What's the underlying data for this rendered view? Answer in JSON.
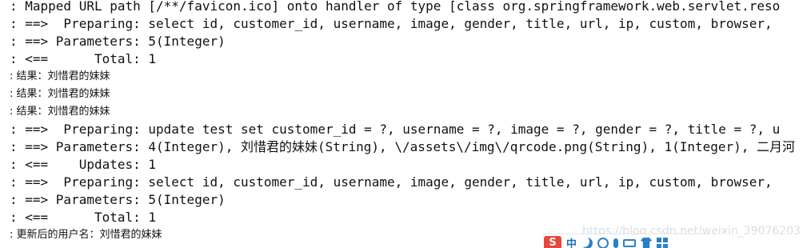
{
  "console": {
    "lines": [
      ": Mapped URL path [/**/favicon.ico] onto handler of type [class org.springframework.web.servlet.reso",
      ": ==>  Preparing: select id, customer_id, username, image, gender, title, url, ip, custom, browser,",
      ": ==> Parameters: 5(Integer)",
      ": <==      Total: 1",
      ": 结果：刘惜君的妹妹",
      ": 结果：刘惜君的妹妹",
      ": 结果：刘惜君的妹妹",
      ": ==>  Preparing: update test set customer_id = ?, username = ?, image = ?, gender = ?, title = ?, u",
      ": ==> Parameters: 4(Integer), 刘惜君的妹妹(String), \\/assets\\/img\\/qrcode.png(String), 1(Integer), 二月河",
      ": <==    Updates: 1",
      ": ==>  Preparing: select id, customer_id, username, image, gender, title, url, ip, custom, browser,",
      ": ==> Parameters: 5(Integer)",
      ": <==      Total: 1",
      ": 更新后的用户名：刘惜君的妹妹"
    ]
  },
  "watermark": "https://blog.csdn.net/weixin_39076203",
  "ime_toolbar": {
    "logo": "S",
    "mode": "中",
    "icons": [
      "moon-icon",
      "smile-icon",
      "microphone-icon",
      "keyboard-icon",
      "shirt-icon",
      "grid-icon"
    ],
    "colors": {
      "logo": "#e8473b",
      "icon": "#2a80c8"
    }
  }
}
